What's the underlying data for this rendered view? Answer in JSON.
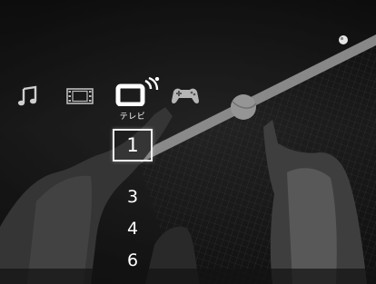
{
  "xmb": {
    "categories": [
      {
        "id": "music",
        "icon": "music-note-icon"
      },
      {
        "id": "video",
        "icon": "film-strip-icon"
      },
      {
        "id": "tv",
        "icon": "tv-icon",
        "label": "テレビ",
        "selected": true
      },
      {
        "id": "game",
        "icon": "gamepad-icon"
      }
    ],
    "selected_label": "テレビ"
  },
  "channels": {
    "selected": "1",
    "items": [
      "3",
      "4",
      "6"
    ]
  },
  "indicators": {
    "status_icon": "status-dot-icon"
  },
  "colors": {
    "text": "#ffffff",
    "background": "#0c0c0c"
  }
}
